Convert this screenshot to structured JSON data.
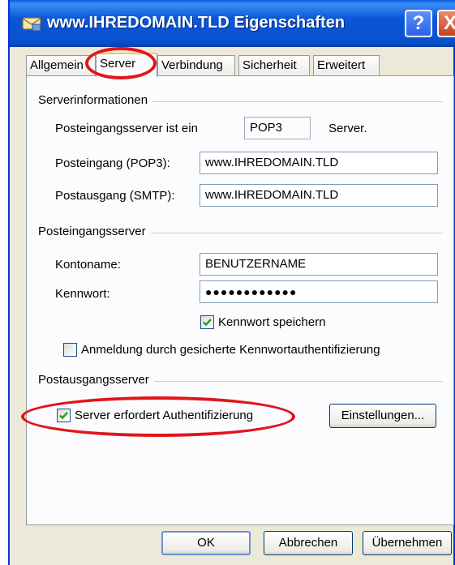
{
  "window": {
    "title": "www.IHREDOMAIN.TLD Eigenschaften",
    "help_glyph": "?",
    "close_glyph": "X"
  },
  "tabs": [
    {
      "label": "Allgemein"
    },
    {
      "label": "Server"
    },
    {
      "label": "Verbindung"
    },
    {
      "label": "Sicherheit"
    },
    {
      "label": "Erweitert"
    }
  ],
  "active_tab": "Server",
  "serverinfo": {
    "group_label": "Serverinformationen",
    "type_label": "Posteingangsserver ist ein",
    "type_value": "POP3",
    "type_suffix": "Server.",
    "incoming_label": "Posteingang (POP3):",
    "incoming_value": "www.IHREDOMAIN.TLD",
    "outgoing_label": "Postausgang (SMTP):",
    "outgoing_value": "www.IHREDOMAIN.TLD"
  },
  "incoming": {
    "group_label": "Posteingangsserver",
    "account_label": "Kontoname:",
    "account_value": "BENUTZERNAME",
    "password_label": "Kennwort:",
    "password_value": "●●●●●●●●●●●●",
    "remember_label": "Kennwort speichern",
    "remember_checked": true,
    "spa_label": "Anmeldung durch gesicherte Kennwortauthentifizierung",
    "spa_checked": false
  },
  "outgoing": {
    "group_label": "Postausgangsserver",
    "auth_label": "Server erfordert Authentifizierung",
    "auth_checked": true,
    "settings_button": "Einstellungen..."
  },
  "buttons": {
    "ok": "OK",
    "cancel": "Abbrechen",
    "apply": "Übernehmen"
  },
  "colors": {
    "titlebar": "#0a56d8",
    "dialog_bg": "#ece9d8",
    "highlight_red": "#e0161c",
    "check_green": "#21a121"
  }
}
